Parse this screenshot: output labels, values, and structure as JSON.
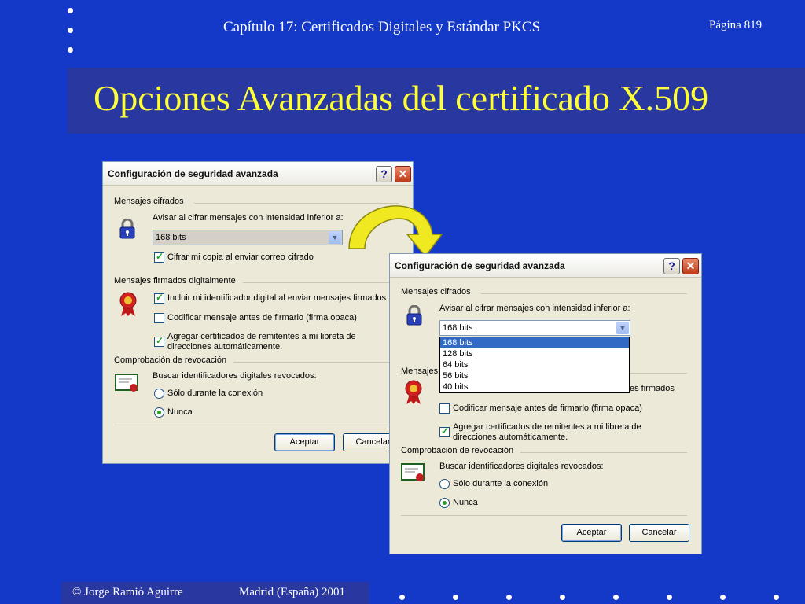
{
  "slide": {
    "header": "Capítulo 17: Certificados Digitales y Estándar PKCS",
    "page": "Página 819",
    "title": "Opciones Avanzadas del certificado X.509",
    "footer_copyright": "©  Jorge Ramió Aguirre",
    "footer_place": "Madrid (España) 2001"
  },
  "colors": {
    "slide_bg": "#1438c8",
    "title_band": "#2838a0",
    "title_text": "#ffff38",
    "arrow_fill": "#f0e820"
  },
  "dialog_left": {
    "title": "Configuración de seguridad avanzada",
    "help_label": "?",
    "close_label": "✕",
    "group_encrypted": "Mensajes cifrados",
    "warn_label": "Avisar al cifrar mensajes con intensidad inferior a:",
    "strength_value": "168 bits",
    "copy_label": "Cifrar mi copia al enviar correo cifrado",
    "group_signed": "Mensajes firmados digitalmente",
    "include_id_label": "Incluir mi identificador digital al enviar mensajes firmados",
    "encode_label": "Codificar mensaje antes de firmarlo (firma opaca)",
    "add_certs_label_1": "Agregar certificados de remitentes a mi libreta de",
    "add_certs_label_2": "direcciones automáticamente.",
    "group_revocation": "Comprobación de revocación",
    "search_label": "Buscar identificadores digitales revocados:",
    "only_online_label": "Sólo durante la conexión",
    "never_label": "Nunca",
    "accept_label": "Aceptar",
    "cancel_label": "Cancelar",
    "checkbox_states": {
      "copy": true,
      "include_id": true,
      "encode": false,
      "add_certs": true
    },
    "selected_radio": "never"
  },
  "dialog_right": {
    "title": "Configuración de seguridad avanzada",
    "help_label": "?",
    "close_label": "✕",
    "group_encrypted": "Mensajes cifrados",
    "warn_label": "Avisar al cifrar mensajes con intensidad inferior a:",
    "strength_value": "168 bits",
    "dropdown_options": [
      "168 bits",
      "128 bits",
      "64 bits",
      "56 bits",
      "40 bits"
    ],
    "dropdown_selected": "168 bits",
    "group_signed_partial": "Mensajes",
    "include_id_partial": "es firmados",
    "encode_label": "Codificar mensaje antes de firmarlo (firma opaca)",
    "add_certs_label_1": "Agregar certificados de remitentes a mi libreta de",
    "add_certs_label_2": "direcciones automáticamente.",
    "group_revocation": "Comprobación de revocación",
    "search_label": "Buscar identificadores digitales revocados:",
    "only_online_label": "Sólo durante la conexión",
    "never_label": "Nunca",
    "accept_label": "Aceptar",
    "cancel_label": "Cancelar",
    "checkbox_states": {
      "encode": false,
      "add_certs": true
    },
    "selected_radio": "never"
  }
}
